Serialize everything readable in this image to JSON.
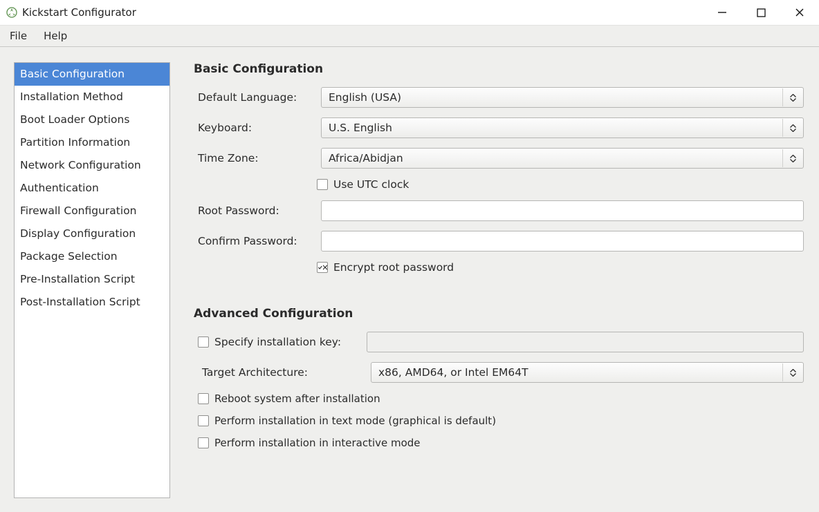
{
  "window": {
    "title": "Kickstart Configurator"
  },
  "menu": {
    "file": "File",
    "help": "Help"
  },
  "sidebar": {
    "items": [
      "Basic Configuration",
      "Installation Method",
      "Boot Loader Options",
      "Partition Information",
      "Network Configuration",
      "Authentication",
      "Firewall Configuration",
      "Display Configuration",
      "Package Selection",
      "Pre-Installation Script",
      "Post-Installation Script"
    ],
    "selected_index": 0
  },
  "basic": {
    "title": "Basic Configuration",
    "language_label": "Default Language:",
    "language_value": "English (USA)",
    "keyboard_label": "Keyboard:",
    "keyboard_value": "U.S. English",
    "timezone_label": "Time Zone:",
    "timezone_value": "Africa/Abidjan",
    "utc_label": "Use UTC clock",
    "utc_checked": false,
    "root_pw_label": "Root Password:",
    "root_pw_value": "",
    "confirm_pw_label": "Confirm Password:",
    "confirm_pw_value": "",
    "encrypt_label": "Encrypt root password",
    "encrypt_checked": true
  },
  "advanced": {
    "title": "Advanced Configuration",
    "install_key_label": "Specify installation key:",
    "install_key_checked": false,
    "install_key_value": "",
    "arch_label": "Target Architecture:",
    "arch_value": "x86, AMD64, or Intel EM64T",
    "reboot_label": "Reboot system after installation",
    "reboot_checked": false,
    "textmode_label": "Perform installation in text mode (graphical is default)",
    "textmode_checked": false,
    "interactive_label": "Perform installation in interactive mode",
    "interactive_checked": false
  }
}
